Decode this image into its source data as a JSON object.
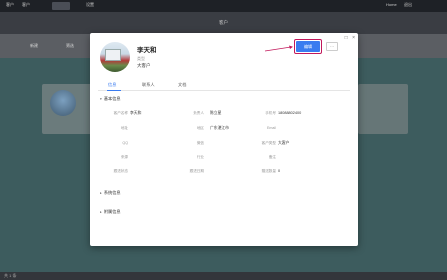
{
  "topbar": {
    "items": [
      "客户",
      "客户",
      "设置"
    ],
    "right_items": [
      "Home",
      "退出"
    ]
  },
  "subheader": {
    "title": "客户"
  },
  "toolbar": {
    "items": [
      "新建",
      "筛选"
    ]
  },
  "footer": {
    "text": "共 1 条"
  },
  "modal": {
    "name": "李天和",
    "sub_label": "类型",
    "sub_value": "大客户",
    "primary_button": "编辑",
    "more_button": "···",
    "window_icons": [
      "□",
      "×"
    ],
    "tabs": [
      "信息",
      "联系人",
      "文档"
    ],
    "active_tab": 0,
    "sections": {
      "basic": "基本信息",
      "system": "系统信息",
      "other": "附属信息"
    },
    "fields": {
      "name_label": "客户名称",
      "name_value": "李天和",
      "owner_label": "负责人",
      "owner_value": "陈立星",
      "phone_label": "手机号",
      "phone_value": "18088802400",
      "addr_label": "地址",
      "region_label": "地区",
      "region_value": "广东湛江市",
      "email_label": "Email",
      "qq_label": "QQ",
      "wechat_label": "微信",
      "level_label": "客户类型",
      "level_value": "大客户",
      "source_label": "来源",
      "industry_label": "行业",
      "remark_label": "备注",
      "followup_label": "跟进状态",
      "nextfollow_label": "跟进日期",
      "deal_label": "赠送数量",
      "deal_value": "0"
    }
  },
  "colors": {
    "accent": "#3a7cf0",
    "highlight": "#c2185b"
  }
}
